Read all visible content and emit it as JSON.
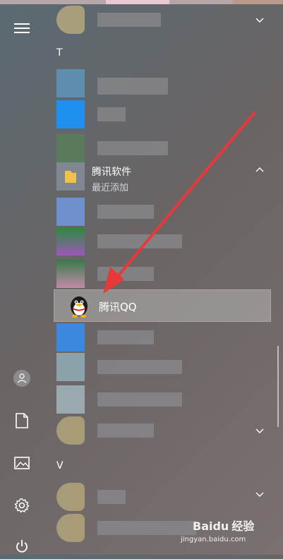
{
  "sections": {
    "t_letter": "T",
    "v_letter": "V"
  },
  "folder": {
    "title": "腾讯软件",
    "subtitle": "最近添加"
  },
  "selected_app": {
    "label": "腾讯QQ"
  },
  "watermark": {
    "brand": "Baidu",
    "suffix": "经验",
    "url": "jingyan.baidu.com"
  },
  "icons": {
    "menu": "hamburger-menu-icon",
    "user": "user-avatar-icon",
    "documents": "document-icon",
    "pictures": "pictures-icon",
    "settings": "gear-icon",
    "power": "power-icon",
    "qq": "qq-penguin-icon",
    "folder": "folder-icon"
  },
  "colors": {
    "arrow": "#e8393a",
    "selected_bg": "#9a9898"
  }
}
